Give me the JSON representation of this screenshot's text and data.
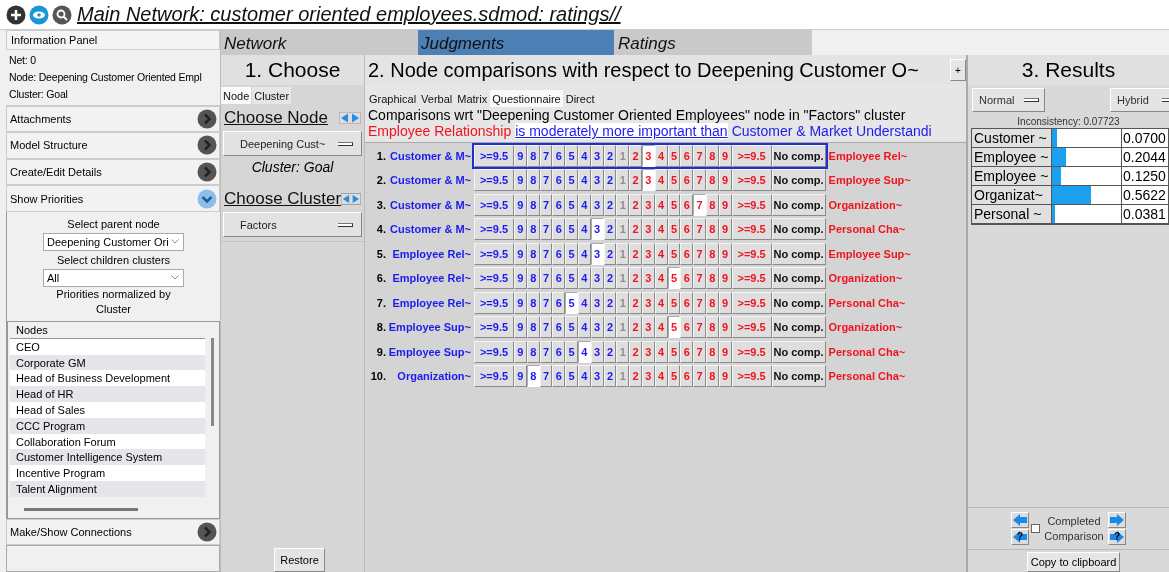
{
  "title": "Main Network: customer oriented employees.sdmod: ratings//",
  "info_panel": {
    "title": "Information Panel",
    "lines": [
      "Net: 0",
      "Node: Deepening Customer Oriented Empl",
      "Cluster: Goal"
    ]
  },
  "accordion": [
    {
      "label": "Attachments",
      "expanded": false
    },
    {
      "label": "Model Structure",
      "expanded": false
    },
    {
      "label": "Create/Edit Details",
      "expanded": false
    },
    {
      "label": "Show Priorities",
      "expanded": true
    }
  ],
  "priorities": {
    "parent_label": "Select parent node",
    "parent_value": "Deepening Customer Ori",
    "children_label": "Select children clusters",
    "children_value": "All",
    "note": "Priorities normalized by Cluster",
    "nodes_header": "Nodes",
    "nodes": [
      "CEO",
      "Corporate GM",
      "Head of Business Development",
      "Head of HR",
      "Head of Sales",
      "CCC Program",
      "Collaboration Forum",
      "Customer Intelligence System",
      "Incentive Program",
      "Talent Alignment"
    ]
  },
  "accordion_bottom": {
    "label": "Make/Show Connections",
    "expanded": false
  },
  "main_tabs": [
    {
      "label": "Network",
      "selected": false
    },
    {
      "label": "Judgments",
      "selected": true
    },
    {
      "label": "Ratings",
      "selected": false
    }
  ],
  "choose": {
    "title": "1. Choose",
    "tabs": [
      {
        "label": "Node",
        "selected": true
      },
      {
        "label": "Cluster",
        "selected": false
      }
    ],
    "node_link": "Choose Node",
    "node_value": "Deepening Cust~",
    "cluster_note": "Cluster: Goal",
    "cluster_link": "Choose Cluster",
    "cluster_value": "Factors",
    "restore": "Restore"
  },
  "comparisons": {
    "title": "2. Node comparisons with respect to Deepening Customer O~",
    "expand": "+",
    "tabs": [
      {
        "label": "Graphical",
        "selected": false
      },
      {
        "label": "Verbal",
        "selected": false
      },
      {
        "label": "Matrix",
        "selected": false
      },
      {
        "label": "Questionnaire",
        "selected": true
      },
      {
        "label": "Direct",
        "selected": false
      }
    ],
    "heading": "Comparisons wrt \"Deepening Customer Oriented Employees\" node in \"Factors\" cluster",
    "verbal": {
      "subject": "Employee Relationship",
      "phrase": "is moderately more important than",
      "object": "Customer & Market Understandi"
    },
    "rows": [
      {
        "num": "1.",
        "left": "Customer & M~",
        "right": "Employee Rel~",
        "focused": true,
        "cells": [
          {
            "t": ">=9.5",
            "kind": "left",
            "selected": false
          },
          {
            "t": "9",
            "kind": "left",
            "selected": false
          },
          {
            "t": "8",
            "kind": "left",
            "selected": false
          },
          {
            "t": "7",
            "kind": "left",
            "selected": false
          },
          {
            "t": "6",
            "kind": "left",
            "selected": false
          },
          {
            "t": "5",
            "kind": "left",
            "selected": false
          },
          {
            "t": "4",
            "kind": "left",
            "selected": false
          },
          {
            "t": "3",
            "kind": "left",
            "selected": false
          },
          {
            "t": "2",
            "kind": "left",
            "selected": false
          },
          {
            "t": "1",
            "kind": "center",
            "selected": false
          },
          {
            "t": "2",
            "kind": "right",
            "selected": false
          },
          {
            "t": "3",
            "kind": "right",
            "selected": true
          },
          {
            "t": "4",
            "kind": "right",
            "selected": false
          },
          {
            "t": "5",
            "kind": "right",
            "selected": false
          },
          {
            "t": "6",
            "kind": "right",
            "selected": false
          },
          {
            "t": "7",
            "kind": "right",
            "selected": false
          },
          {
            "t": "8",
            "kind": "right",
            "selected": false
          },
          {
            "t": "9",
            "kind": "right",
            "selected": false
          },
          {
            "t": ">=9.5",
            "kind": "right",
            "selected": false
          },
          {
            "t": "No comp.",
            "kind": "none",
            "selected": false
          }
        ]
      },
      {
        "num": "2.",
        "left": "Customer & M~",
        "right": "Employee Sup~",
        "focused": false,
        "cells": [
          {
            "t": ">=9.5",
            "kind": "left",
            "selected": false
          },
          {
            "t": "9",
            "kind": "left",
            "selected": false
          },
          {
            "t": "8",
            "kind": "left",
            "selected": false
          },
          {
            "t": "7",
            "kind": "left",
            "selected": false
          },
          {
            "t": "6",
            "kind": "left",
            "selected": false
          },
          {
            "t": "5",
            "kind": "left",
            "selected": false
          },
          {
            "t": "4",
            "kind": "left",
            "selected": false
          },
          {
            "t": "3",
            "kind": "left",
            "selected": false
          },
          {
            "t": "2",
            "kind": "left",
            "selected": false
          },
          {
            "t": "1",
            "kind": "center",
            "selected": false
          },
          {
            "t": "2",
            "kind": "right",
            "selected": false
          },
          {
            "t": "3",
            "kind": "right",
            "selected": true
          },
          {
            "t": "4",
            "kind": "right",
            "selected": false
          },
          {
            "t": "5",
            "kind": "right",
            "selected": false
          },
          {
            "t": "6",
            "kind": "right",
            "selected": false
          },
          {
            "t": "7",
            "kind": "right",
            "selected": false
          },
          {
            "t": "8",
            "kind": "right",
            "selected": false
          },
          {
            "t": "9",
            "kind": "right",
            "selected": false
          },
          {
            "t": ">=9.5",
            "kind": "right",
            "selected": false
          },
          {
            "t": "No comp.",
            "kind": "none",
            "selected": false
          }
        ]
      },
      {
        "num": "3.",
        "left": "Customer & M~",
        "right": "Organization~",
        "focused": false,
        "cells": [
          {
            "t": ">=9.5",
            "kind": "left",
            "selected": false
          },
          {
            "t": "9",
            "kind": "left",
            "selected": false
          },
          {
            "t": "8",
            "kind": "left",
            "selected": false
          },
          {
            "t": "7",
            "kind": "left",
            "selected": false
          },
          {
            "t": "6",
            "kind": "left",
            "selected": false
          },
          {
            "t": "5",
            "kind": "left",
            "selected": false
          },
          {
            "t": "4",
            "kind": "left",
            "selected": false
          },
          {
            "t": "3",
            "kind": "left",
            "selected": false
          },
          {
            "t": "2",
            "kind": "left",
            "selected": false
          },
          {
            "t": "1",
            "kind": "center",
            "selected": false
          },
          {
            "t": "2",
            "kind": "right",
            "selected": false
          },
          {
            "t": "3",
            "kind": "right",
            "selected": false
          },
          {
            "t": "4",
            "kind": "right",
            "selected": false
          },
          {
            "t": "5",
            "kind": "right",
            "selected": false
          },
          {
            "t": "6",
            "kind": "right",
            "selected": false
          },
          {
            "t": "7",
            "kind": "right",
            "selected": true
          },
          {
            "t": "8",
            "kind": "right",
            "selected": false
          },
          {
            "t": "9",
            "kind": "right",
            "selected": false
          },
          {
            "t": ">=9.5",
            "kind": "right",
            "selected": false
          },
          {
            "t": "No comp.",
            "kind": "none",
            "selected": false
          }
        ]
      },
      {
        "num": "4.",
        "left": "Customer & M~",
        "right": "Personal Cha~",
        "focused": false,
        "cells": [
          {
            "t": ">=9.5",
            "kind": "left",
            "selected": false
          },
          {
            "t": "9",
            "kind": "left",
            "selected": false
          },
          {
            "t": "8",
            "kind": "left",
            "selected": false
          },
          {
            "t": "7",
            "kind": "left",
            "selected": false
          },
          {
            "t": "6",
            "kind": "left",
            "selected": false
          },
          {
            "t": "5",
            "kind": "left",
            "selected": false
          },
          {
            "t": "4",
            "kind": "left",
            "selected": false
          },
          {
            "t": "3",
            "kind": "left",
            "selected": true
          },
          {
            "t": "2",
            "kind": "left",
            "selected": false
          },
          {
            "t": "1",
            "kind": "center",
            "selected": false
          },
          {
            "t": "2",
            "kind": "right",
            "selected": false
          },
          {
            "t": "3",
            "kind": "right",
            "selected": false
          },
          {
            "t": "4",
            "kind": "right",
            "selected": false
          },
          {
            "t": "5",
            "kind": "right",
            "selected": false
          },
          {
            "t": "6",
            "kind": "right",
            "selected": false
          },
          {
            "t": "7",
            "kind": "right",
            "selected": false
          },
          {
            "t": "8",
            "kind": "right",
            "selected": false
          },
          {
            "t": "9",
            "kind": "right",
            "selected": false
          },
          {
            "t": ">=9.5",
            "kind": "right",
            "selected": false
          },
          {
            "t": "No comp.",
            "kind": "none",
            "selected": false
          }
        ]
      },
      {
        "num": "5.",
        "left": "Employee Rel~",
        "right": "Employee Sup~",
        "focused": false,
        "cells": [
          {
            "t": ">=9.5",
            "kind": "left",
            "selected": false
          },
          {
            "t": "9",
            "kind": "left",
            "selected": false
          },
          {
            "t": "8",
            "kind": "left",
            "selected": false
          },
          {
            "t": "7",
            "kind": "left",
            "selected": false
          },
          {
            "t": "6",
            "kind": "left",
            "selected": false
          },
          {
            "t": "5",
            "kind": "left",
            "selected": false
          },
          {
            "t": "4",
            "kind": "left",
            "selected": false
          },
          {
            "t": "3",
            "kind": "left",
            "selected": true
          },
          {
            "t": "2",
            "kind": "left",
            "selected": false
          },
          {
            "t": "1",
            "kind": "center",
            "selected": false
          },
          {
            "t": "2",
            "kind": "right",
            "selected": false
          },
          {
            "t": "3",
            "kind": "right",
            "selected": false
          },
          {
            "t": "4",
            "kind": "right",
            "selected": false
          },
          {
            "t": "5",
            "kind": "right",
            "selected": false
          },
          {
            "t": "6",
            "kind": "right",
            "selected": false
          },
          {
            "t": "7",
            "kind": "right",
            "selected": false
          },
          {
            "t": "8",
            "kind": "right",
            "selected": false
          },
          {
            "t": "9",
            "kind": "right",
            "selected": false
          },
          {
            "t": ">=9.5",
            "kind": "right",
            "selected": false
          },
          {
            "t": "No comp.",
            "kind": "none",
            "selected": false
          }
        ]
      },
      {
        "num": "6.",
        "left": "Employee Rel~",
        "right": "Organization~",
        "focused": false,
        "cells": [
          {
            "t": ">=9.5",
            "kind": "left",
            "selected": false
          },
          {
            "t": "9",
            "kind": "left",
            "selected": false
          },
          {
            "t": "8",
            "kind": "left",
            "selected": false
          },
          {
            "t": "7",
            "kind": "left",
            "selected": false
          },
          {
            "t": "6",
            "kind": "left",
            "selected": false
          },
          {
            "t": "5",
            "kind": "left",
            "selected": false
          },
          {
            "t": "4",
            "kind": "left",
            "selected": false
          },
          {
            "t": "3",
            "kind": "left",
            "selected": false
          },
          {
            "t": "2",
            "kind": "left",
            "selected": false
          },
          {
            "t": "1",
            "kind": "center",
            "selected": false
          },
          {
            "t": "2",
            "kind": "right",
            "selected": false
          },
          {
            "t": "3",
            "kind": "right",
            "selected": false
          },
          {
            "t": "4",
            "kind": "right",
            "selected": false
          },
          {
            "t": "5",
            "kind": "right",
            "selected": true
          },
          {
            "t": "6",
            "kind": "right",
            "selected": false
          },
          {
            "t": "7",
            "kind": "right",
            "selected": false
          },
          {
            "t": "8",
            "kind": "right",
            "selected": false
          },
          {
            "t": "9",
            "kind": "right",
            "selected": false
          },
          {
            "t": ">=9.5",
            "kind": "right",
            "selected": false
          },
          {
            "t": "No comp.",
            "kind": "none",
            "selected": false
          }
        ]
      },
      {
        "num": "7.",
        "left": "Employee Rel~",
        "right": "Personal Cha~",
        "focused": false,
        "cells": [
          {
            "t": ">=9.5",
            "kind": "left",
            "selected": false
          },
          {
            "t": "9",
            "kind": "left",
            "selected": false
          },
          {
            "t": "8",
            "kind": "left",
            "selected": false
          },
          {
            "t": "7",
            "kind": "left",
            "selected": false
          },
          {
            "t": "6",
            "kind": "left",
            "selected": false
          },
          {
            "t": "5",
            "kind": "left",
            "selected": true
          },
          {
            "t": "4",
            "kind": "left",
            "selected": false
          },
          {
            "t": "3",
            "kind": "left",
            "selected": false
          },
          {
            "t": "2",
            "kind": "left",
            "selected": false
          },
          {
            "t": "1",
            "kind": "center",
            "selected": false
          },
          {
            "t": "2",
            "kind": "right",
            "selected": false
          },
          {
            "t": "3",
            "kind": "right",
            "selected": false
          },
          {
            "t": "4",
            "kind": "right",
            "selected": false
          },
          {
            "t": "5",
            "kind": "right",
            "selected": false
          },
          {
            "t": "6",
            "kind": "right",
            "selected": false
          },
          {
            "t": "7",
            "kind": "right",
            "selected": false
          },
          {
            "t": "8",
            "kind": "right",
            "selected": false
          },
          {
            "t": "9",
            "kind": "right",
            "selected": false
          },
          {
            "t": ">=9.5",
            "kind": "right",
            "selected": false
          },
          {
            "t": "No comp.",
            "kind": "none",
            "selected": false
          }
        ]
      },
      {
        "num": "8.",
        "left": "Employee Sup~",
        "right": "Organization~",
        "focused": false,
        "cells": [
          {
            "t": ">=9.5",
            "kind": "left",
            "selected": false
          },
          {
            "t": "9",
            "kind": "left",
            "selected": false
          },
          {
            "t": "8",
            "kind": "left",
            "selected": false
          },
          {
            "t": "7",
            "kind": "left",
            "selected": false
          },
          {
            "t": "6",
            "kind": "left",
            "selected": false
          },
          {
            "t": "5",
            "kind": "left",
            "selected": false
          },
          {
            "t": "4",
            "kind": "left",
            "selected": false
          },
          {
            "t": "3",
            "kind": "left",
            "selected": false
          },
          {
            "t": "2",
            "kind": "left",
            "selected": false
          },
          {
            "t": "1",
            "kind": "center",
            "selected": false
          },
          {
            "t": "2",
            "kind": "right",
            "selected": false
          },
          {
            "t": "3",
            "kind": "right",
            "selected": false
          },
          {
            "t": "4",
            "kind": "right",
            "selected": false
          },
          {
            "t": "5",
            "kind": "right",
            "selected": true
          },
          {
            "t": "6",
            "kind": "right",
            "selected": false
          },
          {
            "t": "7",
            "kind": "right",
            "selected": false
          },
          {
            "t": "8",
            "kind": "right",
            "selected": false
          },
          {
            "t": "9",
            "kind": "right",
            "selected": false
          },
          {
            "t": ">=9.5",
            "kind": "right",
            "selected": false
          },
          {
            "t": "No comp.",
            "kind": "none",
            "selected": false
          }
        ]
      },
      {
        "num": "9.",
        "left": "Employee Sup~",
        "right": "Personal Cha~",
        "focused": false,
        "cells": [
          {
            "t": ">=9.5",
            "kind": "left",
            "selected": false
          },
          {
            "t": "9",
            "kind": "left",
            "selected": false
          },
          {
            "t": "8",
            "kind": "left",
            "selected": false
          },
          {
            "t": "7",
            "kind": "left",
            "selected": false
          },
          {
            "t": "6",
            "kind": "left",
            "selected": false
          },
          {
            "t": "5",
            "kind": "left",
            "selected": false
          },
          {
            "t": "4",
            "kind": "left",
            "selected": true
          },
          {
            "t": "3",
            "kind": "left",
            "selected": false
          },
          {
            "t": "2",
            "kind": "left",
            "selected": false
          },
          {
            "t": "1",
            "kind": "center",
            "selected": false
          },
          {
            "t": "2",
            "kind": "right",
            "selected": false
          },
          {
            "t": "3",
            "kind": "right",
            "selected": false
          },
          {
            "t": "4",
            "kind": "right",
            "selected": false
          },
          {
            "t": "5",
            "kind": "right",
            "selected": false
          },
          {
            "t": "6",
            "kind": "right",
            "selected": false
          },
          {
            "t": "7",
            "kind": "right",
            "selected": false
          },
          {
            "t": "8",
            "kind": "right",
            "selected": false
          },
          {
            "t": "9",
            "kind": "right",
            "selected": false
          },
          {
            "t": ">=9.5",
            "kind": "right",
            "selected": false
          },
          {
            "t": "No comp.",
            "kind": "none",
            "selected": false
          }
        ]
      },
      {
        "num": "10.",
        "left": "Organization~",
        "right": "Personal Cha~",
        "focused": false,
        "cells": [
          {
            "t": ">=9.5",
            "kind": "left",
            "selected": false
          },
          {
            "t": "9",
            "kind": "left",
            "selected": false
          },
          {
            "t": "8",
            "kind": "left",
            "selected": true
          },
          {
            "t": "7",
            "kind": "left",
            "selected": false
          },
          {
            "t": "6",
            "kind": "left",
            "selected": false
          },
          {
            "t": "5",
            "kind": "left",
            "selected": false
          },
          {
            "t": "4",
            "kind": "left",
            "selected": false
          },
          {
            "t": "3",
            "kind": "left",
            "selected": false
          },
          {
            "t": "2",
            "kind": "left",
            "selected": false
          },
          {
            "t": "1",
            "kind": "center",
            "selected": false
          },
          {
            "t": "2",
            "kind": "right",
            "selected": false
          },
          {
            "t": "3",
            "kind": "right",
            "selected": false
          },
          {
            "t": "4",
            "kind": "right",
            "selected": false
          },
          {
            "t": "5",
            "kind": "right",
            "selected": false
          },
          {
            "t": "6",
            "kind": "right",
            "selected": false
          },
          {
            "t": "7",
            "kind": "right",
            "selected": false
          },
          {
            "t": "8",
            "kind": "right",
            "selected": false
          },
          {
            "t": "9",
            "kind": "right",
            "selected": false
          },
          {
            "t": ">=9.5",
            "kind": "right",
            "selected": false
          },
          {
            "t": "No comp.",
            "kind": "none",
            "selected": false
          }
        ]
      }
    ]
  },
  "results": {
    "title": "3. Results",
    "mode": "Normal",
    "method": "Hybrid",
    "inconsistency": "Inconsistency: 0.07723",
    "rows": [
      {
        "name": "Customer ~",
        "level": 0.07,
        "value": "0.0700"
      },
      {
        "name": "Employee ~",
        "level": 0.204,
        "value": "0.2044"
      },
      {
        "name": "Employee ~",
        "level": 0.125,
        "value": "0.1250"
      },
      {
        "name": "Organizat~",
        "level": 0.562,
        "value": "0.5622"
      },
      {
        "name": "Personal ~",
        "level": 0.038,
        "value": "0.0381"
      }
    ],
    "nav": [
      {
        "kind": "prev"
      },
      {
        "kind": "next"
      },
      {
        "kind": "prev",
        "label": "?"
      },
      {
        "kind": "next",
        "label": "?"
      }
    ],
    "completed": {
      "label": "Completed Comparison",
      "checked": false
    },
    "copy": "Copy to clipboard"
  }
}
